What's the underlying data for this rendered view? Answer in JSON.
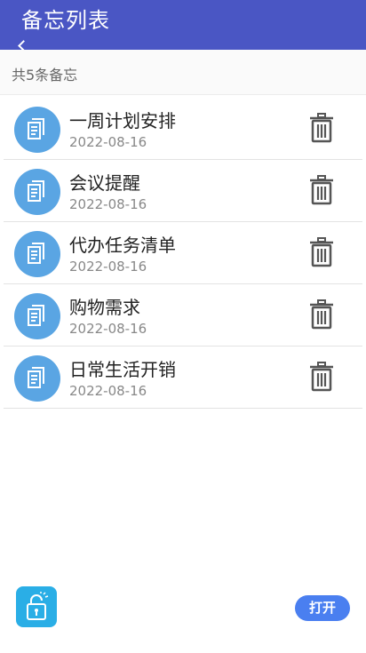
{
  "header": {
    "title": "备忘列表"
  },
  "summary": {
    "count_text": "共5条备忘"
  },
  "memos": [
    {
      "title": "一周计划安排",
      "date": "2022-08-16"
    },
    {
      "title": "会议提醒",
      "date": "2022-08-16"
    },
    {
      "title": "代办任务清单",
      "date": "2022-08-16"
    },
    {
      "title": "购物需求",
      "date": "2022-08-16"
    },
    {
      "title": "日常生活开销",
      "date": "2022-08-16"
    }
  ],
  "actions": {
    "open_label": "打开"
  },
  "icons": {
    "memo": "memo-icon",
    "delete": "trash-icon",
    "lock": "lock-icon",
    "back": "back-arrow-icon"
  },
  "colors": {
    "header_bg": "#4a56c4",
    "memo_icon_bg": "#5aa5e3",
    "lock_bg": "#2aaee6",
    "open_button_bg": "#4a7ff0"
  }
}
